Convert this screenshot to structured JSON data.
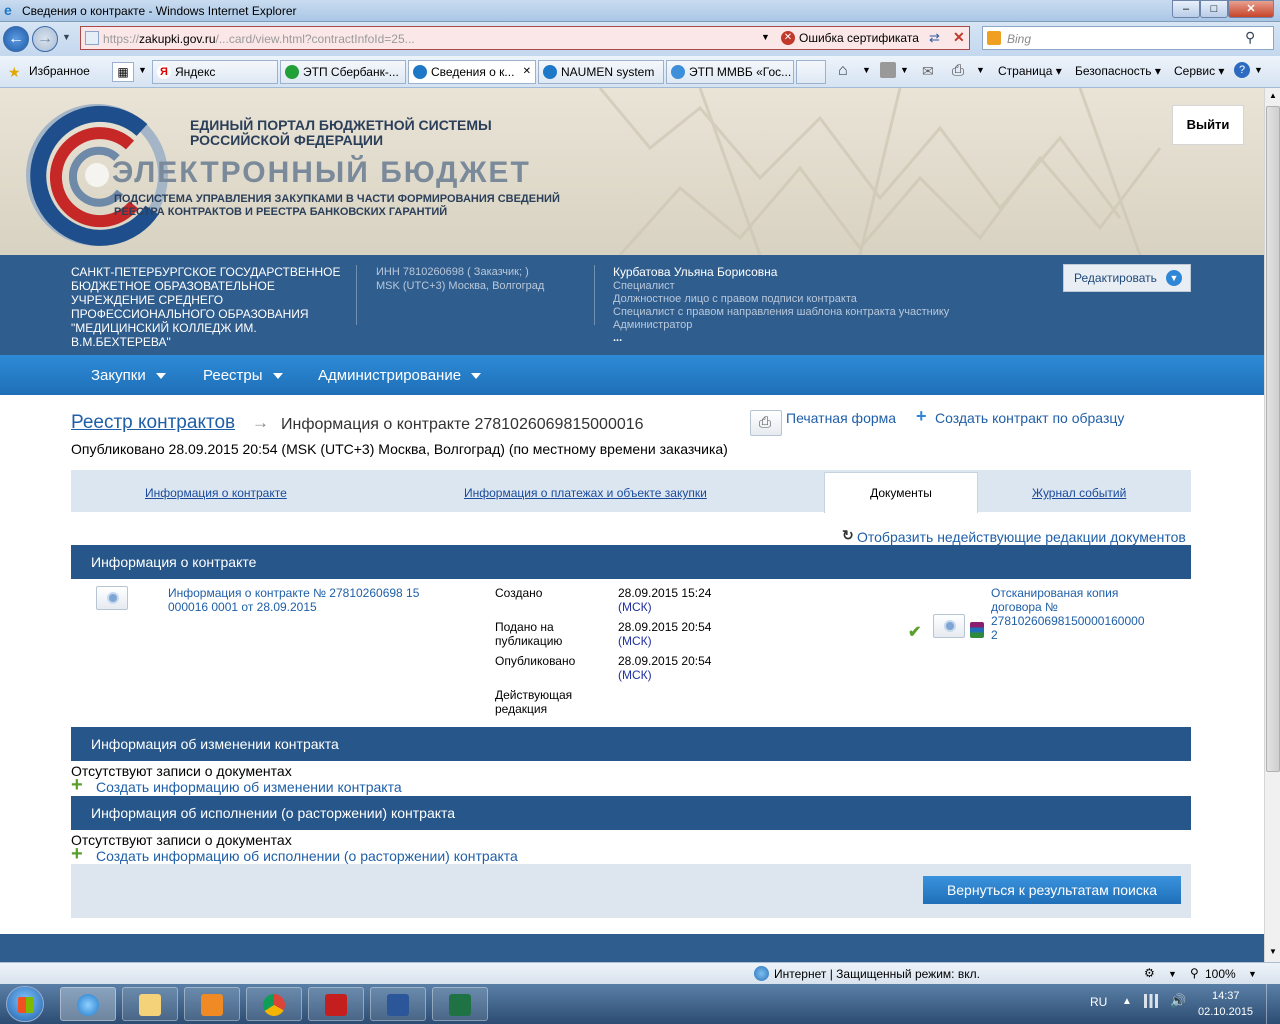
{
  "window": {
    "title": "Сведения о контракте - Windows Internet Explorer"
  },
  "address": {
    "url_prefix": "https://",
    "domain": "zakupki.gov.ru",
    "url_rest": "/...card/view.html?contractInfoId=25...",
    "cert_error": "Ошибка сертификата",
    "search_placeholder": "Bing"
  },
  "favorites": {
    "label": "Избранное",
    "tabs": [
      "Яндекс",
      "ЭТП Сбербанк-...",
      "Сведения о к...",
      "NAUMEN system",
      "ЭТП ММВБ «Гос..."
    ]
  },
  "commands": {
    "page": "Страница",
    "security": "Безопасность",
    "service": "Сервис"
  },
  "header": {
    "portal_line1": "ЕДИНЫЙ ПОРТАЛ БЮДЖЕТНОЙ СИСТЕМЫ",
    "portal_line2": "РОССИЙСКОЙ ФЕДЕРАЦИИ",
    "brand": "ЭЛЕКТРОННЫЙ БЮДЖЕТ",
    "sub_line1": "ПОДСИСТЕМА УПРАВЛЕНИЯ ЗАКУПКАМИ В ЧАСТИ ФОРМИРОВАНИЯ СВЕДЕНИЙ",
    "sub_line2": "РЕЕСТРА КОНТРАКТОВ И РЕЕСТРА БАНКОВСКИХ ГАРАНТИЙ",
    "logout": "Выйти"
  },
  "org": {
    "name_lines": [
      "САНКТ-ПЕТЕРБУРГСКОЕ ГОСУДАРСТВЕННОЕ",
      "БЮДЖЕТНОЕ ОБРАЗОВАТЕЛЬНОЕ",
      "УЧРЕЖДЕНИЕ СРЕДНЕГО",
      "ПРОФЕССИОНАЛЬНОГО ОБРАЗОВАНИЯ",
      "\"МЕДИЦИНСКИЙ КОЛЛЕДЖ ИМ.",
      "В.М.БЕХТЕРЕВА\""
    ],
    "inn": "ИНН 7810260698 ( Заказчик; )",
    "tz": "MSK (UTC+3) Москва, Волгоград",
    "user": "Курбатова Ульяна Борисовна",
    "roles": [
      "Специалист",
      "Должностное лицо с правом подписи контракта",
      "Специалист с правом направления шаблона контракта участнику",
      "Администратор",
      "..."
    ],
    "edit": "Редактировать"
  },
  "menu": [
    "Закупки",
    "Реестры",
    "Администрирование"
  ],
  "breadcrumb": {
    "root": "Реестр контрактов",
    "current": "Информация о контракте 2781026069815000016"
  },
  "published": "Опубликовано 28.09.2015 20:54 (MSK (UTC+3) Москва, Волгоград) (по местному времени заказчика)",
  "actions": {
    "print": "Печатная форма",
    "create_by_sample": "Создать контракт по образцу"
  },
  "tabs": [
    "Информация о контракте",
    "Информация о платежах и объекте закупки",
    "Документы",
    "Журнал событий"
  ],
  "show_inactive": "Отобразить недействующие редакции документов",
  "sections": {
    "info": "Информация о контракте",
    "change": "Информация об изменении контракта",
    "execution": "Информация об исполнении (о расторжении) контракта"
  },
  "doc": {
    "title_lines": [
      "Информация о контракте № 27810260698 15",
      "000016 0001 от 28.09.2015"
    ],
    "labels": [
      "Создано",
      "Подано на\nпубликацию",
      "Опубликовано",
      "Действующая\nредакция"
    ],
    "created": "28.09.2015 15:24",
    "submitted": "28.09.2015 20:54",
    "published": "28.09.2015 20:54",
    "tz_short": "(МСК)",
    "scan_lines": [
      "Отсканированая копия",
      "договора №",
      "27810260698150000160000",
      "2"
    ]
  },
  "empty": "Отсутствуют записи о документах",
  "create_change": "Создать информацию об изменении контракта",
  "create_exec": "Создать информацию об исполнении (о расторжении) контракта",
  "back": "Вернуться к результатам поиска",
  "status": {
    "zone": "Интернет | Защищенный режим: вкл.",
    "zoom": "100%"
  },
  "tray": {
    "lang": "RU",
    "time": "14:37",
    "date": "02.10.2015"
  }
}
